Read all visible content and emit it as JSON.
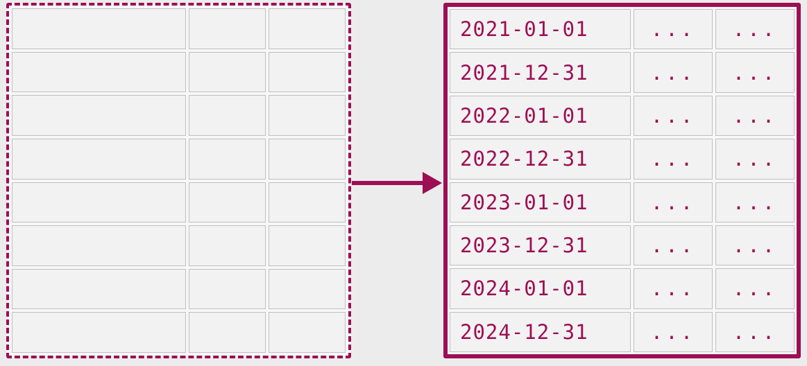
{
  "accent_color": "#9c0f54",
  "left_table": {
    "rows": 8,
    "cols": 3,
    "cells": [
      [
        "",
        "",
        ""
      ],
      [
        "",
        "",
        ""
      ],
      [
        "",
        "",
        ""
      ],
      [
        "",
        "",
        ""
      ],
      [
        "",
        "",
        ""
      ],
      [
        "",
        "",
        ""
      ],
      [
        "",
        "",
        ""
      ],
      [
        "",
        "",
        ""
      ]
    ]
  },
  "right_table": {
    "rows": [
      {
        "date": "2021-01-01",
        "c2": "...",
        "c3": "..."
      },
      {
        "date": "2021-12-31",
        "c2": "...",
        "c3": "..."
      },
      {
        "date": "2022-01-01",
        "c2": "...",
        "c3": "..."
      },
      {
        "date": "2022-12-31",
        "c2": "...",
        "c3": "..."
      },
      {
        "date": "2023-01-01",
        "c2": "...",
        "c3": "..."
      },
      {
        "date": "2023-12-31",
        "c2": "...",
        "c3": "..."
      },
      {
        "date": "2024-01-01",
        "c2": "...",
        "c3": "..."
      },
      {
        "date": "2024-12-31",
        "c2": "...",
        "c3": "..."
      }
    ]
  }
}
